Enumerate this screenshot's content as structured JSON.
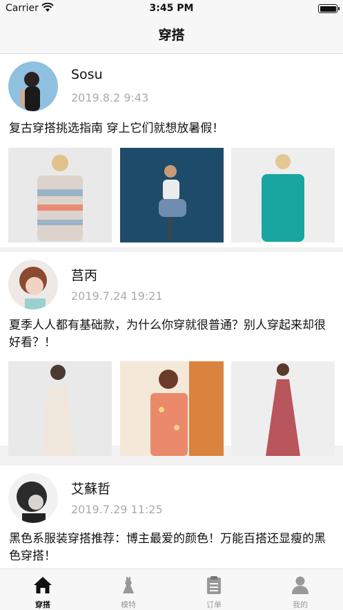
{
  "status_bar": {
    "carrier": "Carrier",
    "time": "3:45 PM"
  },
  "nav": {
    "title": "穿搭"
  },
  "posts": [
    {
      "username": "Sosu",
      "time": "2019.8.2 9:43",
      "text": "复古穿搭挑选指南 穿上它们就想放暑假！"
    },
    {
      "username": "莒丙",
      "time": "2019.7.24 19:21",
      "text": "夏季人人都有基础款，为什么你穿就很普通？别人穿起来却很好看？！"
    },
    {
      "username": "艾蘇哲",
      "time": "2019.7.29 11:25",
      "text": "黑色系服装穿搭推荐：博主最爱的颜色！万能百搭还显瘦的黑色穿搭！"
    }
  ],
  "tabs": [
    {
      "label": "穿搭",
      "icon": "home-icon",
      "active": true
    },
    {
      "label": "模特",
      "icon": "dress-icon",
      "active": false
    },
    {
      "label": "订单",
      "icon": "clipboard-icon",
      "active": false
    },
    {
      "label": "我的",
      "icon": "person-icon",
      "active": false
    }
  ],
  "colors": {
    "active_tab": "#111111",
    "inactive_tab": "#999999",
    "timestamp": "#aaaaaa"
  }
}
